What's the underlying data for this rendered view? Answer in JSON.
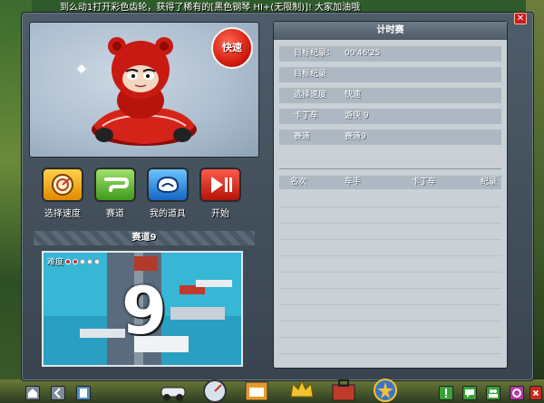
{
  "ticker": {
    "text": "到么动1打开彩色齿轮，获得了稀有的[黑色钢琴 HI+(无限制)]! 大家加油哦"
  },
  "preview": {
    "mode_badge": "快速"
  },
  "actions": [
    {
      "label": "选择速度",
      "icon": "speed-dial-icon"
    },
    {
      "label": "赛道",
      "icon": "track-icon"
    },
    {
      "label": "我的道具",
      "icon": "items-icon"
    },
    {
      "label": "开始",
      "icon": "play-pause-icon"
    }
  ],
  "track": {
    "bar_label": "赛道9",
    "difficulty_label": "难度",
    "difficulty_level": 2,
    "difficulty_max": 5,
    "number_label": "9"
  },
  "right_panel": {
    "title": "计时赛",
    "rows": [
      {
        "label": "目标纪录：",
        "value": "00'46'25"
      },
      {
        "label": "目标纪录",
        "value": ""
      },
      {
        "label": "选择速度",
        "value": "快速"
      },
      {
        "label": "卡丁车",
        "value": "游侠 9"
      },
      {
        "label": "赛道",
        "value": "赛道9"
      }
    ],
    "rank_headers": [
      "名次",
      "车手",
      "卡丁车",
      "纪录"
    ]
  },
  "colors": {
    "accent_red": "#d61e10",
    "panel_gray": "#c9d0d6",
    "row_gray": "#aeb8c2",
    "window_dark": "#3e4a55",
    "track_water": "#37b6d5"
  },
  "bottom_bar": {
    "left_icons": [
      "home-icon",
      "back-icon",
      "tablet-icon"
    ],
    "center_icons": [
      "kart-icon",
      "speedometer-icon",
      "shop-icon",
      "crown-icon",
      "toolbox-icon",
      "emblem-icon"
    ],
    "right_icons": [
      "alert-icon",
      "chat-icon",
      "friends-icon",
      "settings-icon",
      "power-icon"
    ]
  }
}
